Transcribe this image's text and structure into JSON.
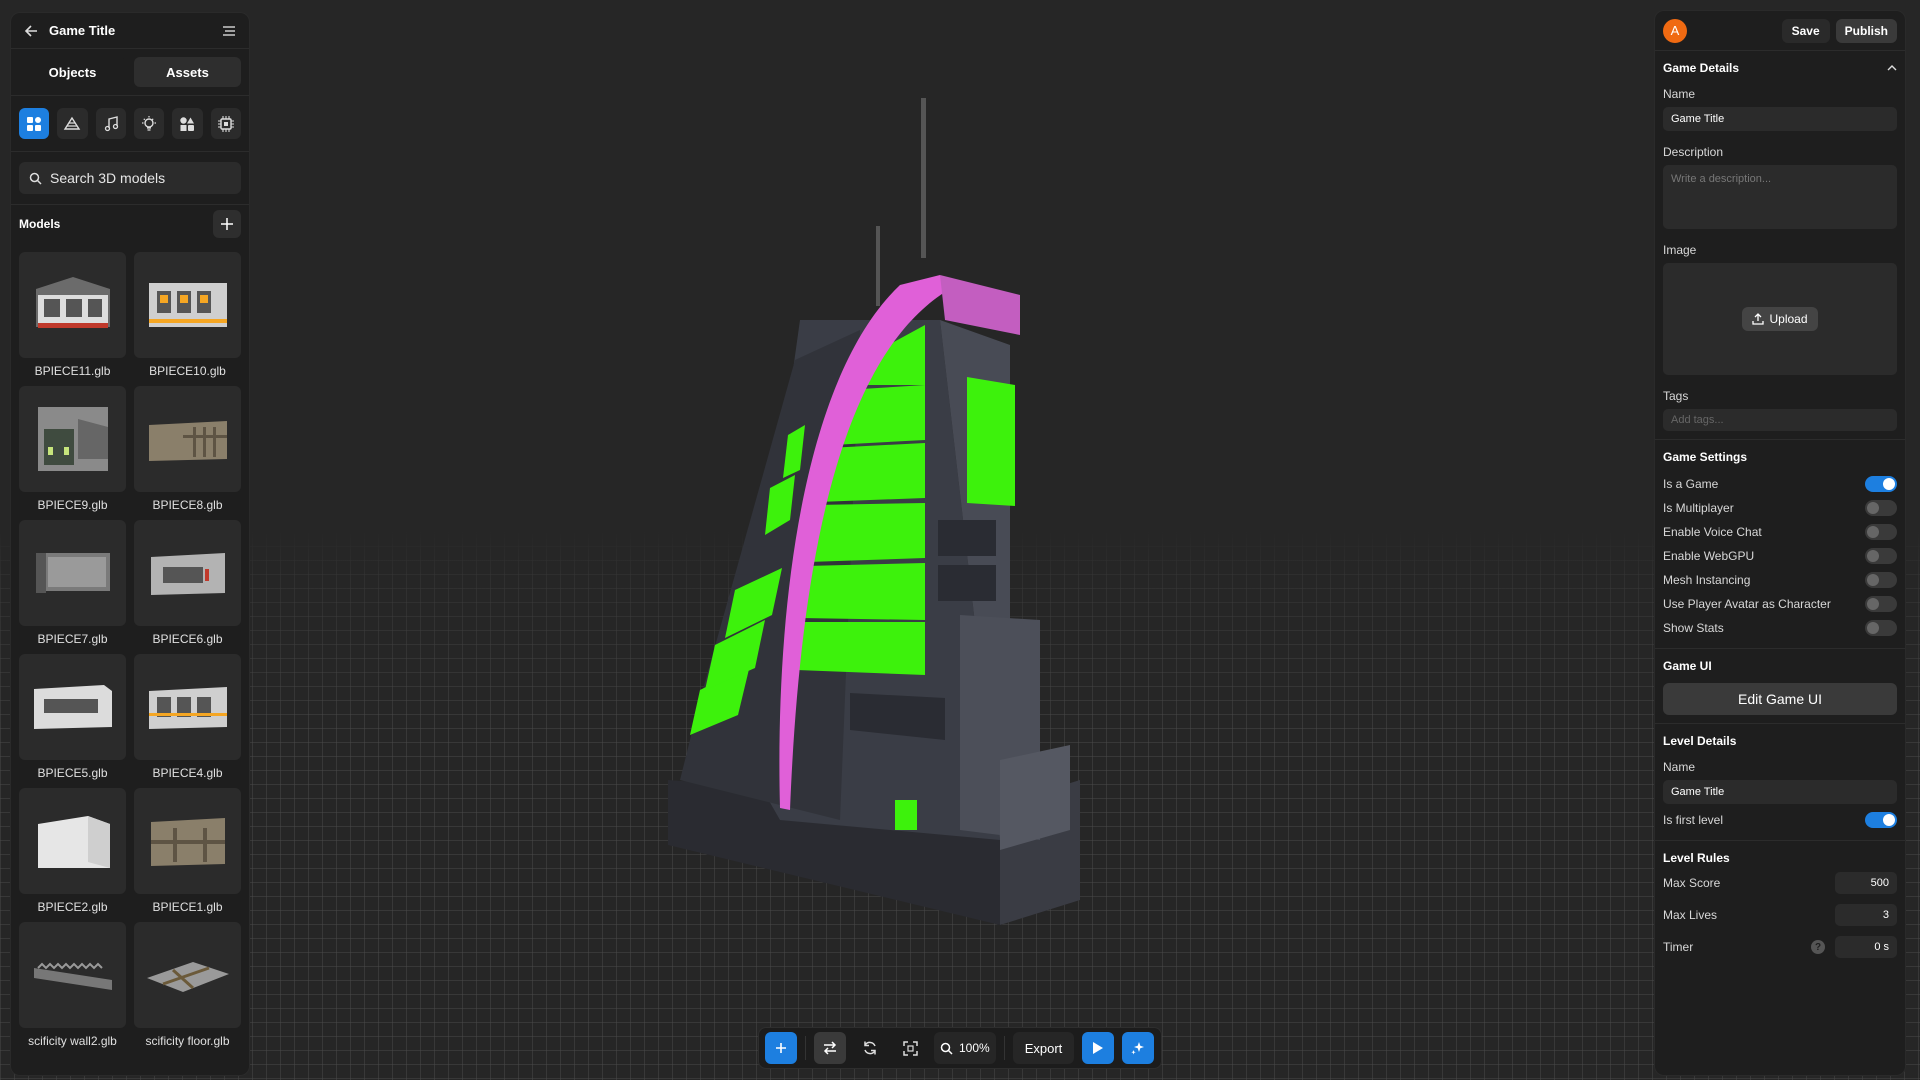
{
  "left_panel": {
    "title": "Game Title",
    "tabs": [
      "Objects",
      "Assets"
    ],
    "categories": [
      "objects-icon",
      "terrain-icon",
      "music-icon",
      "light-icon",
      "shapes-icon",
      "chip-icon"
    ],
    "search_placeholder": "Search 3D models",
    "models_label": "Models",
    "models": [
      "BPIECE11.glb",
      "BPIECE10.glb",
      "BPIECE9.glb",
      "BPIECE8.glb",
      "BPIECE7.glb",
      "BPIECE6.glb",
      "BPIECE5.glb",
      "BPIECE4.glb",
      "BPIECE2.glb",
      "BPIECE1.glb",
      "scificity wall2.glb",
      "scificity floor.glb"
    ]
  },
  "toolbar": {
    "zoom": "100%",
    "export_label": "Export"
  },
  "right_panel": {
    "avatar_initial": "A",
    "save_label": "Save",
    "publish_label": "Publish",
    "game_details": {
      "title": "Game Details",
      "name_label": "Name",
      "name_value": "Game Title",
      "description_label": "Description",
      "description_placeholder": "Write a description...",
      "image_label": "Image",
      "upload_label": "Upload",
      "tags_label": "Tags",
      "tags_placeholder": "Add tags..."
    },
    "game_settings": {
      "title": "Game Settings",
      "toggles": [
        {
          "label": "Is a Game",
          "on": true
        },
        {
          "label": "Is Multiplayer",
          "on": false
        },
        {
          "label": "Enable Voice Chat",
          "on": false
        },
        {
          "label": "Enable WebGPU",
          "on": false
        },
        {
          "label": "Mesh Instancing",
          "on": false
        },
        {
          "label": "Use Player Avatar as Character",
          "on": false
        },
        {
          "label": "Show Stats",
          "on": false
        }
      ]
    },
    "game_ui": {
      "title": "Game UI",
      "edit_label": "Edit Game UI"
    },
    "level_details": {
      "title": "Level Details",
      "name_label": "Name",
      "name_value": "Game Title",
      "first_level_label": "Is first level",
      "first_level_on": true
    },
    "level_rules": {
      "title": "Level Rules",
      "max_score_label": "Max Score",
      "max_score": "500",
      "max_lives_label": "Max Lives",
      "max_lives": "3",
      "timer_label": "Timer",
      "timer": "0 s"
    }
  },
  "colors": {
    "accent": "#1d7fe0",
    "neon_green": "#3df20c",
    "neon_pink": "#e060d8",
    "avatar": "#f06a12"
  }
}
